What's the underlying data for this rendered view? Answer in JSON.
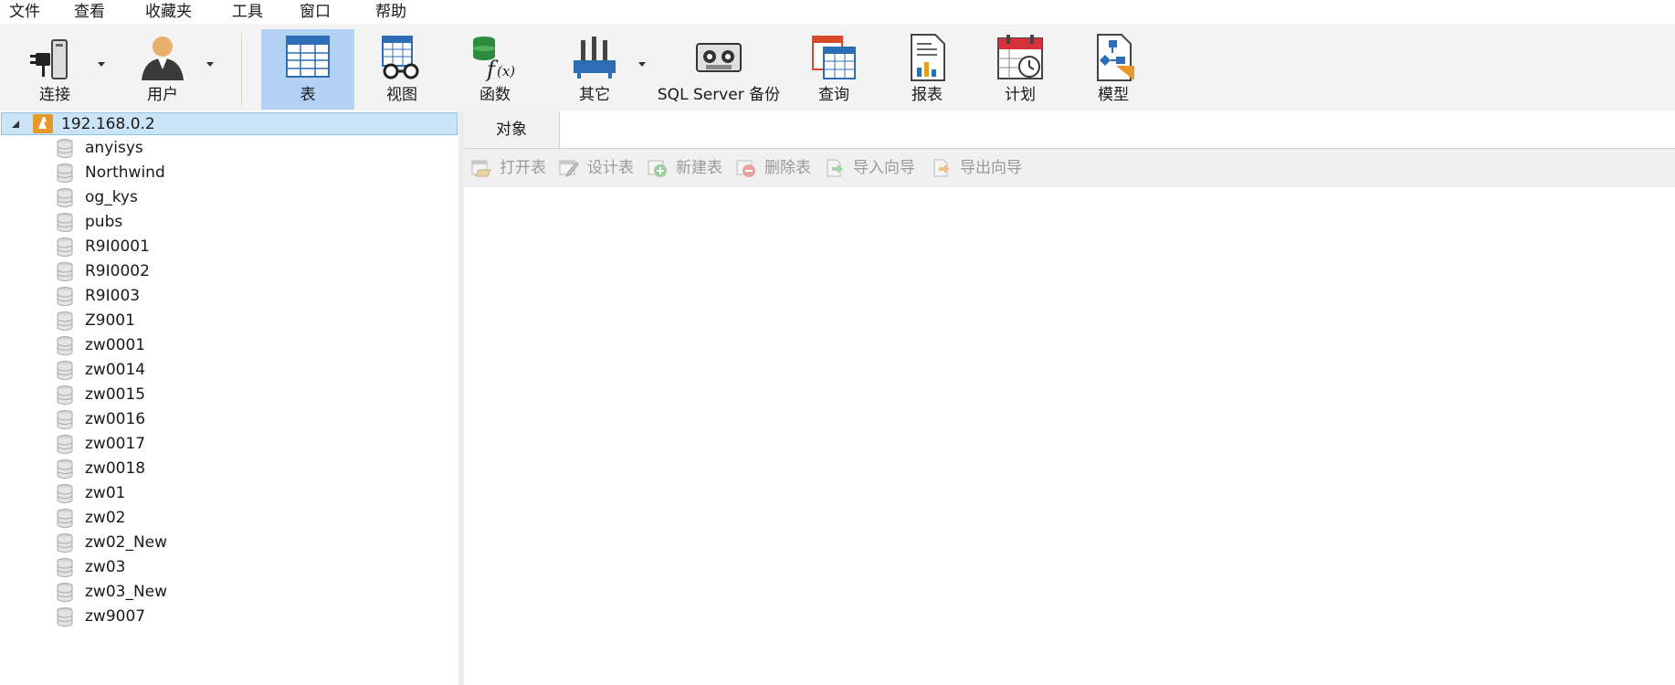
{
  "menu": [
    "文件",
    "查看",
    "收藏夹",
    "工具",
    "窗口",
    "帮助"
  ],
  "toolbar": {
    "connect": "连接",
    "user": "用户",
    "table": "表",
    "view": "视图",
    "function": "函数",
    "other": "其它",
    "backup": "SQL Server 备份",
    "query": "查询",
    "report": "报表",
    "schedule": "计划",
    "model": "模型"
  },
  "tree": {
    "server": "192.168.0.2",
    "databases": [
      "anyisys",
      "Northwind",
      "og_kys",
      "pubs",
      "R9I0001",
      "R9I0002",
      "R9I003",
      "Z9001",
      "zw0001",
      "zw0014",
      "zw0015",
      "zw0016",
      "zw0017",
      "zw0018",
      "zw01",
      "zw02",
      "zw02_New",
      "zw03",
      "zw03_New",
      "zw9007"
    ]
  },
  "tabs": {
    "objects": "对象"
  },
  "object_toolbar": {
    "open": "打开表",
    "design": "设计表",
    "new": "新建表",
    "delete": "删除表",
    "import": "导入向导",
    "export": "导出向导"
  },
  "colors": {
    "selection": "#b3d2f4",
    "tree_selection": "#cce4f7",
    "disabled_text": "#9a9a9a"
  }
}
